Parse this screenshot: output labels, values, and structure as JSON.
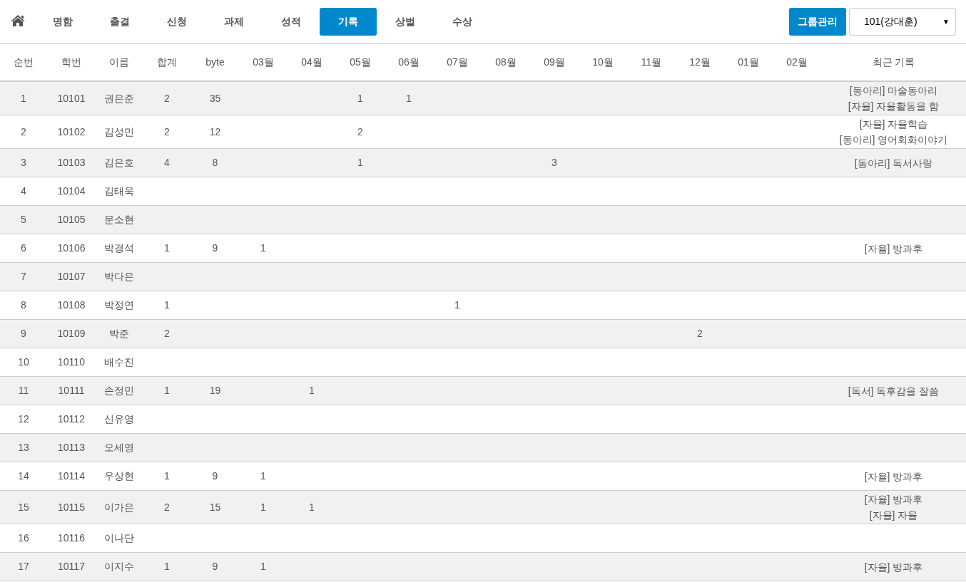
{
  "nav": {
    "tabs": [
      {
        "label": "명함",
        "selected": false
      },
      {
        "label": "출결",
        "selected": false
      },
      {
        "label": "신청",
        "selected": false
      },
      {
        "label": "과제",
        "selected": false
      },
      {
        "label": "성적",
        "selected": false
      },
      {
        "label": "기록",
        "selected": true
      },
      {
        "label": "상벌",
        "selected": false
      },
      {
        "label": "수상",
        "selected": false
      }
    ],
    "group_button": "그룹관리",
    "class_select": {
      "value": "101(강대훈)",
      "arrow": "▼"
    }
  },
  "table": {
    "columns": [
      "순번",
      "학번",
      "이름",
      "합계",
      "byte",
      "03월",
      "04월",
      "05월",
      "06월",
      "07월",
      "08월",
      "09월",
      "10월",
      "11월",
      "12월",
      "01월",
      "02월",
      "최근 기록"
    ],
    "rows": [
      {
        "seq": "1",
        "id": "10101",
        "name": "권은준",
        "total": "2",
        "bytes": "35",
        "months": {
          "m05": "1",
          "m06": "1"
        },
        "recent": [
          "[동아리] 마술동아리",
          "[자율] 자율활동을 함"
        ]
      },
      {
        "seq": "2",
        "id": "10102",
        "name": "김성민",
        "total": "2",
        "bytes": "12",
        "months": {
          "m05": "2"
        },
        "recent": [
          "[자율] 자율학습",
          "[동아리] 영어회화이야기"
        ]
      },
      {
        "seq": "3",
        "id": "10103",
        "name": "김은호",
        "total": "4",
        "bytes": "8",
        "months": {
          "m05": "1",
          "m09": "3"
        },
        "recent": [
          "[동아리] 독서사랑"
        ]
      },
      {
        "seq": "4",
        "id": "10104",
        "name": "김태욱"
      },
      {
        "seq": "5",
        "id": "10105",
        "name": "문소현"
      },
      {
        "seq": "6",
        "id": "10106",
        "name": "박경석",
        "total": "1",
        "bytes": "9",
        "months": {
          "m03": "1"
        },
        "recent": [
          "[자율] 방과후"
        ]
      },
      {
        "seq": "7",
        "id": "10107",
        "name": "박다은"
      },
      {
        "seq": "8",
        "id": "10108",
        "name": "박정연",
        "total": "1",
        "months": {
          "m07": "1"
        }
      },
      {
        "seq": "9",
        "id": "10109",
        "name": "박준",
        "total": "2",
        "months": {
          "m12": "2"
        }
      },
      {
        "seq": "10",
        "id": "10110",
        "name": "배수진"
      },
      {
        "seq": "11",
        "id": "10111",
        "name": "손정민",
        "total": "1",
        "bytes": "19",
        "months": {
          "m04": "1"
        },
        "recent": [
          "[독서] 독후감을 잘씀"
        ]
      },
      {
        "seq": "12",
        "id": "10112",
        "name": "신유영"
      },
      {
        "seq": "13",
        "id": "10113",
        "name": "오세영"
      },
      {
        "seq": "14",
        "id": "10114",
        "name": "우상현",
        "total": "1",
        "bytes": "9",
        "months": {
          "m03": "1"
        },
        "recent": [
          "[자율] 방과후"
        ]
      },
      {
        "seq": "15",
        "id": "10115",
        "name": "이가은",
        "total": "2",
        "bytes": "15",
        "months": {
          "m03": "1",
          "m04": "1"
        },
        "recent": [
          "[자율] 방과후",
          "[자율] 자율"
        ]
      },
      {
        "seq": "16",
        "id": "10116",
        "name": "이나단"
      },
      {
        "seq": "17",
        "id": "10117",
        "name": "이지수",
        "total": "1",
        "bytes": "9",
        "months": {
          "m03": "1"
        },
        "recent": [
          "[자율] 방과후"
        ]
      }
    ]
  }
}
